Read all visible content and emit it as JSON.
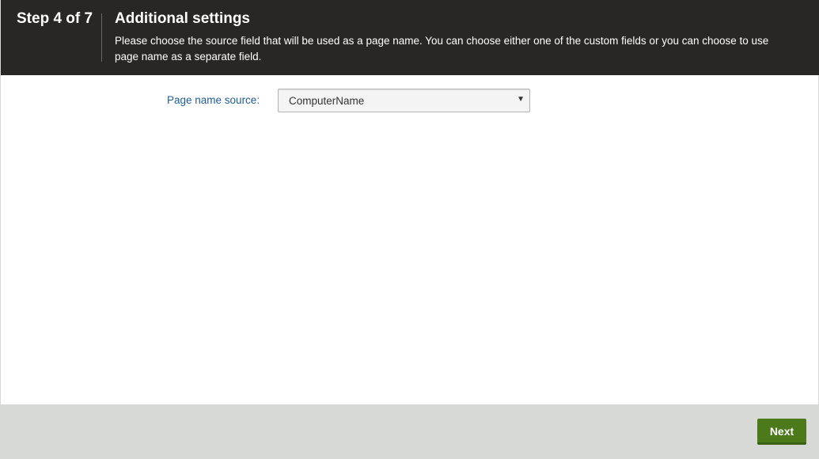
{
  "header": {
    "step": "Step 4 of 7",
    "title": "Additional settings",
    "description": "Please choose the source field that will be used as a page name. You can choose either one of the custom fields or you can choose to use page name as a separate field."
  },
  "form": {
    "page_name_source_label": "Page name source:",
    "page_name_source_value": "ComputerName",
    "dropdown_icon": "triangle-down"
  },
  "footer": {
    "next_label": "Next"
  },
  "colors": {
    "header_bg": "#292725",
    "label_text": "#1f5c99",
    "footer_bg": "#d6d9d6",
    "next_button": "#4c7a1a"
  }
}
